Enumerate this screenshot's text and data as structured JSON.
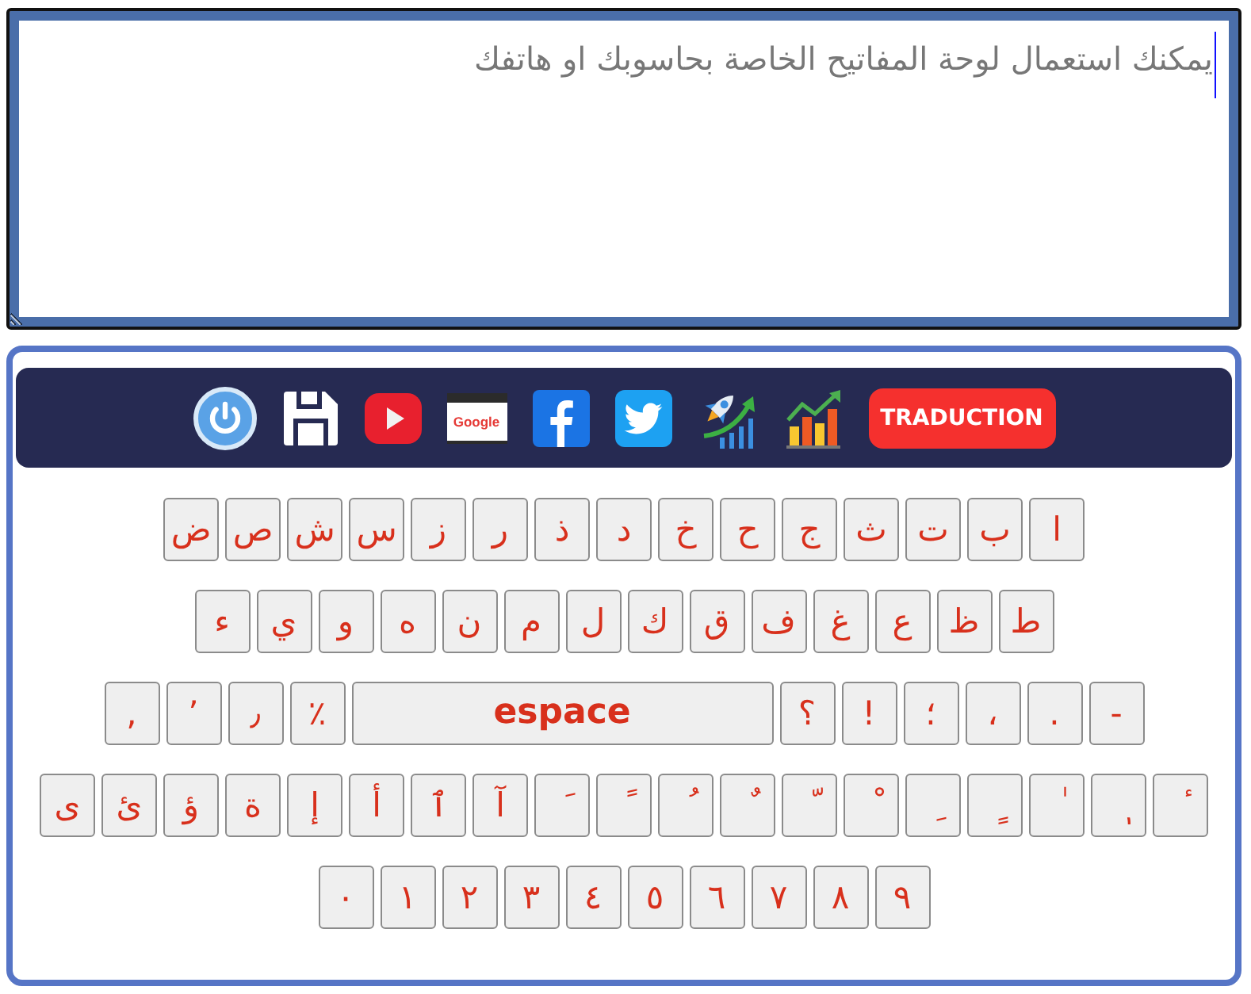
{
  "text_area": {
    "placeholder": "يمكنك استعمال لوحة المفاتيح الخاصة بحاسوبك او هاتفك",
    "focused": true
  },
  "toolbar": {
    "browser_window_label": "Google",
    "button": "TRADUCTION"
  },
  "keyboard": {
    "rows": [
      {
        "keys": [
          {
            "kind": "char",
            "label": "ا"
          },
          {
            "kind": "char",
            "label": "ب"
          },
          {
            "kind": "char",
            "label": "ت"
          },
          {
            "kind": "char",
            "label": "ث"
          },
          {
            "kind": "char",
            "label": "ج"
          },
          {
            "kind": "char",
            "label": "ح"
          },
          {
            "kind": "char",
            "label": "خ"
          },
          {
            "kind": "char",
            "label": "د"
          },
          {
            "kind": "char",
            "label": "ذ"
          },
          {
            "kind": "char",
            "label": "ر"
          },
          {
            "kind": "char",
            "label": "ز"
          },
          {
            "kind": "char",
            "label": "س"
          },
          {
            "kind": "char",
            "label": "ش"
          },
          {
            "kind": "char",
            "label": "ص"
          },
          {
            "kind": "char",
            "label": "ض"
          }
        ]
      },
      {
        "keys": [
          {
            "kind": "char",
            "label": "ط"
          },
          {
            "kind": "char",
            "label": "ظ"
          },
          {
            "kind": "char",
            "label": "ع"
          },
          {
            "kind": "char",
            "label": "غ"
          },
          {
            "kind": "char",
            "label": "ف"
          },
          {
            "kind": "char",
            "label": "ق"
          },
          {
            "kind": "char",
            "label": "ك"
          },
          {
            "kind": "char",
            "label": "ل"
          },
          {
            "kind": "char",
            "label": "م"
          },
          {
            "kind": "char",
            "label": "ن"
          },
          {
            "kind": "char",
            "label": "ه"
          },
          {
            "kind": "char",
            "label": "و"
          },
          {
            "kind": "char",
            "label": "ي"
          },
          {
            "kind": "char",
            "label": "ء"
          }
        ]
      },
      {
        "keys": [
          {
            "kind": "char",
            "label": "-"
          },
          {
            "kind": "char",
            "label": "."
          },
          {
            "kind": "char",
            "label": "،"
          },
          {
            "kind": "char",
            "label": "؛"
          },
          {
            "kind": "char",
            "label": "!"
          },
          {
            "kind": "char",
            "label": "؟"
          },
          {
            "kind": "space",
            "label": "espace"
          },
          {
            "kind": "char",
            "label": "٪"
          },
          {
            "kind": "char",
            "label": "٫"
          },
          {
            "kind": "char",
            "label": "٬"
          },
          {
            "kind": "char",
            "label": ","
          }
        ]
      },
      {
        "keys": [
          {
            "kind": "char",
            "label": "ٔ"
          },
          {
            "kind": "char",
            "label": "ٖ"
          },
          {
            "kind": "char",
            "label": "ٰ"
          },
          {
            "kind": "char",
            "label": "ٍ"
          },
          {
            "kind": "char",
            "label": "ِ"
          },
          {
            "kind": "char",
            "label": "ْ"
          },
          {
            "kind": "char",
            "label": "ّ"
          },
          {
            "kind": "char",
            "label": "ٌ"
          },
          {
            "kind": "char",
            "label": "ُ"
          },
          {
            "kind": "char",
            "label": "ً"
          },
          {
            "kind": "char",
            "label": "َ"
          },
          {
            "kind": "char",
            "label": "آ"
          },
          {
            "kind": "char",
            "label": "ٱ"
          },
          {
            "kind": "char",
            "label": "أ"
          },
          {
            "kind": "char",
            "label": "إ"
          },
          {
            "kind": "char",
            "label": "ة"
          },
          {
            "kind": "char",
            "label": "ؤ"
          },
          {
            "kind": "char",
            "label": "ئ"
          },
          {
            "kind": "char",
            "label": "ى"
          }
        ]
      },
      {
        "keys": [
          {
            "kind": "char",
            "label": "٩"
          },
          {
            "kind": "char",
            "label": "٨"
          },
          {
            "kind": "char",
            "label": "٧"
          },
          {
            "kind": "char",
            "label": "٦"
          },
          {
            "kind": "char",
            "label": "٥"
          },
          {
            "kind": "char",
            "label": "٤"
          },
          {
            "kind": "char",
            "label": "٣"
          },
          {
            "kind": "char",
            "label": "٢"
          },
          {
            "kind": "char",
            "label": "١"
          },
          {
            "kind": "char",
            "label": "٠"
          }
        ]
      }
    ]
  }
}
